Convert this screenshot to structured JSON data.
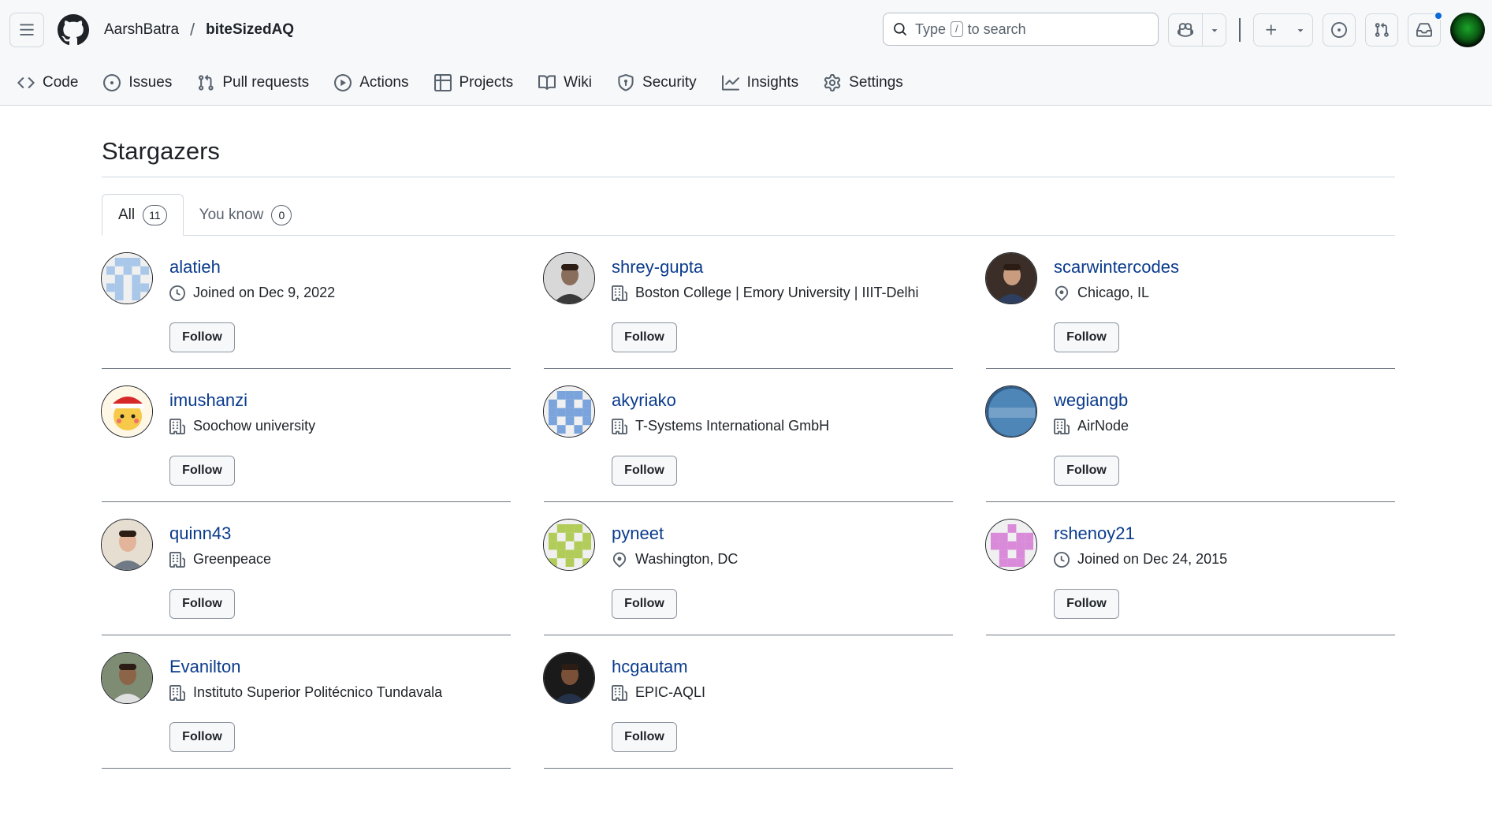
{
  "header": {
    "owner": "AarshBatra",
    "separator": "/",
    "repo": "biteSizedAQ",
    "search": {
      "prefix": "Type",
      "key": "/",
      "suffix": "to search"
    }
  },
  "nav": [
    {
      "label": "Code",
      "icon": "code-icon"
    },
    {
      "label": "Issues",
      "icon": "issue-icon"
    },
    {
      "label": "Pull requests",
      "icon": "pull-request-icon"
    },
    {
      "label": "Actions",
      "icon": "play-icon"
    },
    {
      "label": "Projects",
      "icon": "table-icon"
    },
    {
      "label": "Wiki",
      "icon": "book-icon"
    },
    {
      "label": "Security",
      "icon": "shield-icon"
    },
    {
      "label": "Insights",
      "icon": "graph-icon"
    },
    {
      "label": "Settings",
      "icon": "gear-icon"
    }
  ],
  "page": {
    "title": "Stargazers",
    "tabs": [
      {
        "label": "All",
        "count": "11"
      },
      {
        "label": "You know",
        "count": "0"
      }
    ]
  },
  "follow_label": "Follow",
  "stargazers": [
    {
      "login": "alatieh",
      "meta_icon": "clock-icon",
      "meta": "Joined on Dec 9, 2022",
      "avatar_style": "identicon-blue"
    },
    {
      "login": "shrey-gupta",
      "meta_icon": "building-icon",
      "meta": "Boston College | Emory University | IIIT-Delhi",
      "avatar_style": "photo-gray"
    },
    {
      "login": "scarwintercodes",
      "meta_icon": "location-icon",
      "meta": "Chicago, IL",
      "avatar_style": "photo-dark"
    },
    {
      "login": "imushanzi",
      "meta_icon": "building-icon",
      "meta": "Soochow university",
      "avatar_style": "cartoon"
    },
    {
      "login": "akyriako",
      "meta_icon": "building-icon",
      "meta": "T-Systems International GmbH",
      "avatar_style": "identicon-blue2"
    },
    {
      "login": "wegiangb",
      "meta_icon": "building-icon",
      "meta": "AirNode",
      "avatar_style": "airnode"
    },
    {
      "login": "quinn43",
      "meta_icon": "building-icon",
      "meta": "Greenpeace",
      "avatar_style": "photo-face"
    },
    {
      "login": "pyneet",
      "meta_icon": "location-icon",
      "meta": "Washington, DC",
      "avatar_style": "identicon-green"
    },
    {
      "login": "rshenoy21",
      "meta_icon": "clock-icon",
      "meta": "Joined on Dec 24, 2015",
      "avatar_style": "identicon-pink"
    },
    {
      "login": "Evanilton",
      "meta_icon": "building-icon",
      "meta": "Instituto Superior Politécnico Tundavala",
      "avatar_style": "photo-outdoor"
    },
    {
      "login": "hcgautam",
      "meta_icon": "building-icon",
      "meta": "EPIC-AQLI",
      "avatar_style": "photo-dark2"
    }
  ]
}
